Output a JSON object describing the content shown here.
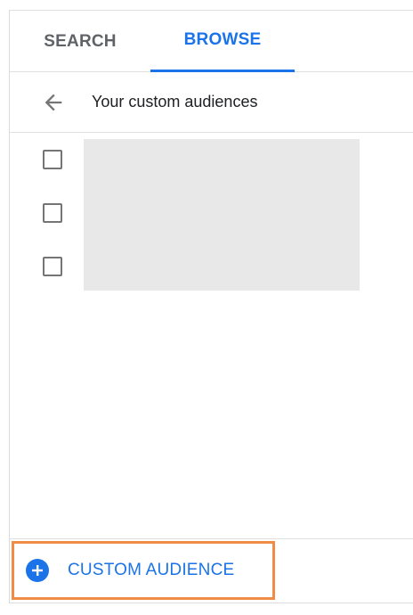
{
  "tabs": [
    {
      "label": "SEARCH",
      "active": false
    },
    {
      "label": "BROWSE",
      "active": true
    }
  ],
  "breadcrumb": {
    "back_icon": "arrow-left-icon",
    "title": "Your custom audiences"
  },
  "audience_list": {
    "rows": [
      {
        "checked": false
      },
      {
        "checked": false
      },
      {
        "checked": false
      }
    ]
  },
  "footer": {
    "add_icon": "plus-circle-icon",
    "add_label": "CUSTOM AUDIENCE"
  },
  "colors": {
    "accent": "#1a73e8",
    "highlight": "#f28b46",
    "placeholder": "#e8e8e8",
    "text_secondary": "#5f6368"
  }
}
